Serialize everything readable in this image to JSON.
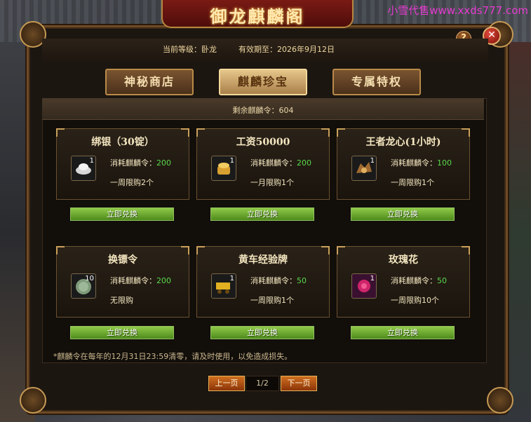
{
  "watermark": "小雪代售www.xxds777.com",
  "window": {
    "title": "御龙麒麟阁",
    "level": "当前等级：卧龙",
    "expiry": "有效期至：2026年9月12日"
  },
  "tabs": [
    {
      "label": "神秘商店",
      "active": false
    },
    {
      "label": "麒麟珍宝",
      "active": true
    },
    {
      "label": "专属特权",
      "active": false
    }
  ],
  "remaining_tokens": "剩余麒麟令：604",
  "cost_prefix": "消耗麒麟令：",
  "items": [
    {
      "name": "绑银（30锭）",
      "count": "1",
      "cost": "200",
      "limit": "一周限购2个",
      "icon": "silver-ingot-icon",
      "button": "立即兑换"
    },
    {
      "name": "工资50000",
      "count": "1",
      "cost": "200",
      "limit": "一月限购1个",
      "icon": "gold-pouch-icon",
      "button": "立即兑换"
    },
    {
      "name": "王者龙心(1小时)",
      "count": "1",
      "cost": "100",
      "limit": "一周限购1个",
      "icon": "dragon-heart-icon",
      "button": "立即兑换"
    },
    {
      "name": "换镖令",
      "count": "10",
      "cost": "200",
      "limit": "无限购",
      "icon": "escort-token-icon",
      "button": "立即兑换"
    },
    {
      "name": "黄车经验牌",
      "count": "1",
      "cost": "50",
      "limit": "一周限购1个",
      "icon": "yellow-cart-exp-icon",
      "button": "立即兑换"
    },
    {
      "name": "玫瑰花",
      "count": "1",
      "cost": "50",
      "limit": "一周限购10个",
      "icon": "rose-icon",
      "button": "立即兑换"
    }
  ],
  "note": "*麒麟令在每年的12月31日23:59清零，请及时使用，以免造成损失。",
  "pagination": {
    "prev": "上一页",
    "page": "1/2",
    "next": "下一页"
  },
  "buttons": {
    "help": "?",
    "close": "✕"
  }
}
